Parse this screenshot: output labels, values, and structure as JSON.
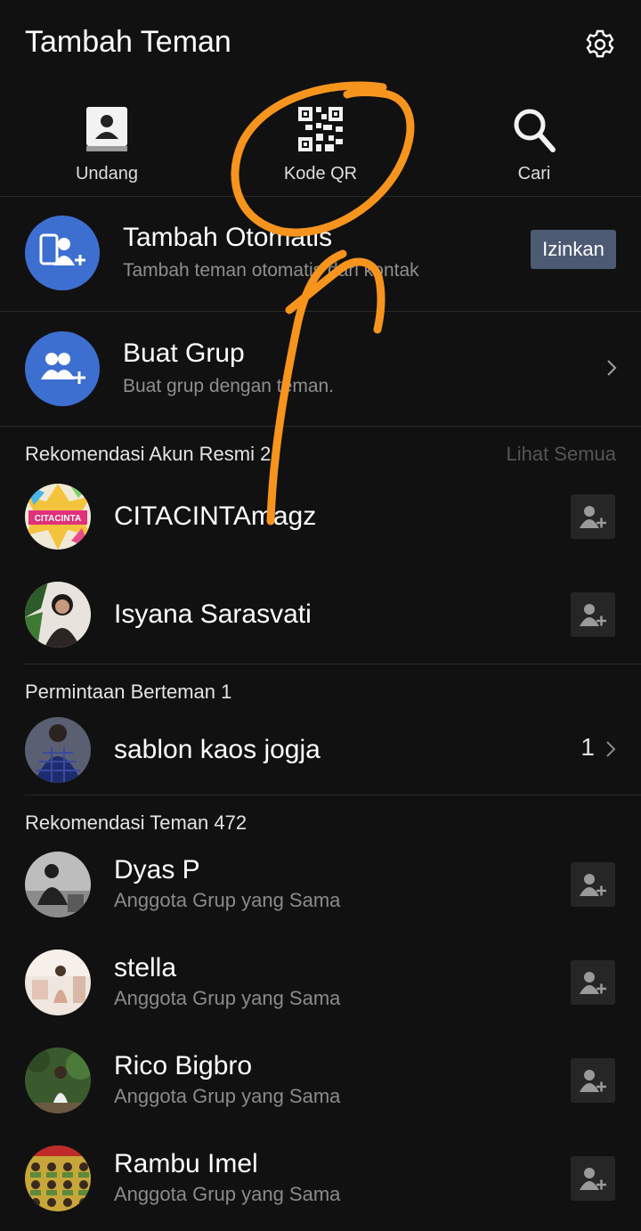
{
  "header": {
    "title": "Tambah Teman",
    "settings_icon": "gear-icon"
  },
  "quick_actions": [
    {
      "label": "Undang",
      "icon": "contact-book-icon"
    },
    {
      "label": "Kode QR",
      "icon": "qr-code-icon"
    },
    {
      "label": "Cari",
      "icon": "search-icon"
    }
  ],
  "auto_add": {
    "title": "Tambah Otomatis",
    "subtitle": "Tambah teman otomatis dari kontak",
    "button": "Izinkan",
    "icon": "phone-add-user-icon"
  },
  "create_group": {
    "title": "Buat Grup",
    "subtitle": "Buat grup dengan teman.",
    "icon": "group-add-icon"
  },
  "official": {
    "header": "Rekomendasi Akun Resmi 2",
    "see_all": "Lihat Semua",
    "items": [
      {
        "name": "CITACINTAmagz",
        "avatar_text": "CITACINTA"
      },
      {
        "name": "Isyana Sarasvati"
      }
    ]
  },
  "requests": {
    "header": "Permintaan Berteman 1",
    "items": [
      {
        "name": "sablon kaos jogja",
        "count": "1"
      }
    ]
  },
  "friends": {
    "header": "Rekomendasi Teman 472",
    "items": [
      {
        "name": "Dyas P",
        "subtitle": "Anggota Grup yang Sama"
      },
      {
        "name": "stella",
        "subtitle": "Anggota Grup yang Sama"
      },
      {
        "name": "Rico Bigbro",
        "subtitle": "Anggota Grup yang Sama"
      },
      {
        "name": "Rambu Imel",
        "subtitle": "Anggota Grup yang Sama"
      }
    ]
  },
  "colors": {
    "background": "#111111",
    "accent_blue": "#3d6fd1",
    "button_bg": "#4d5a74",
    "annotation": "#f7941d"
  }
}
